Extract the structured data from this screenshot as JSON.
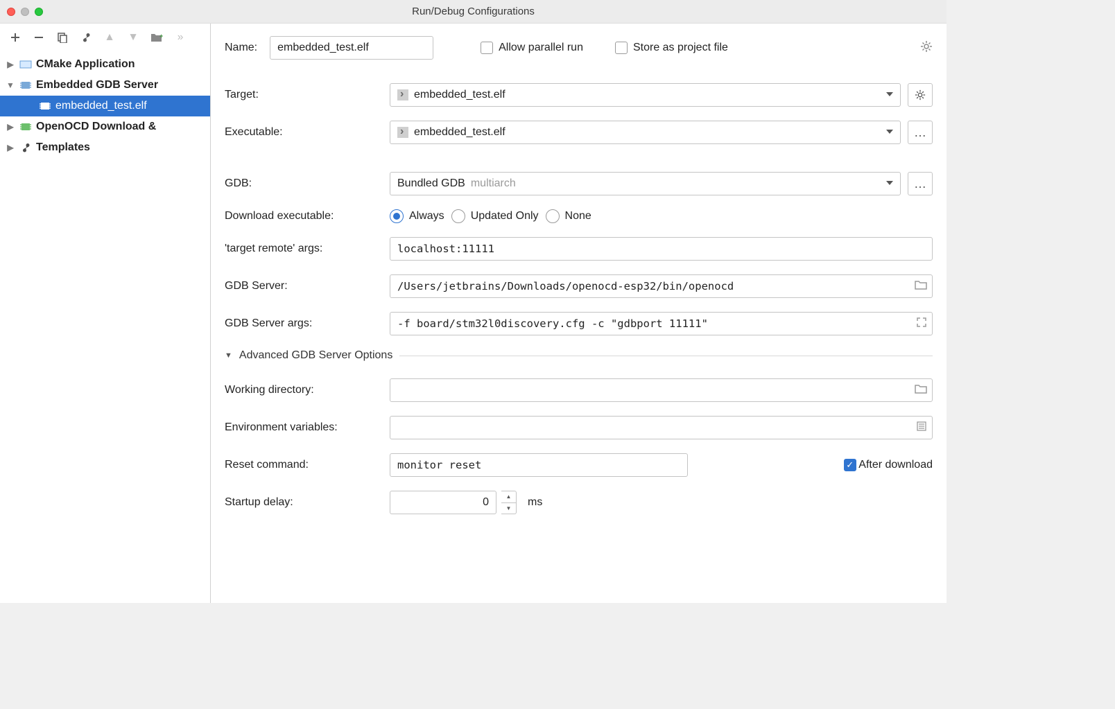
{
  "window": {
    "title": "Run/Debug Configurations"
  },
  "tree": {
    "items": [
      {
        "label": "CMake Application",
        "kind": "cmake"
      },
      {
        "label": "Embedded GDB Server",
        "kind": "chip-blue"
      },
      {
        "label": "embedded_test.elf",
        "kind": "chip-blue"
      },
      {
        "label": "OpenOCD Download & ",
        "kind": "chip-green"
      },
      {
        "label": "Templates",
        "kind": "wrench"
      }
    ]
  },
  "form": {
    "name_label": "Name:",
    "name_value": "embedded_test.elf",
    "allow_parallel": "Allow parallel run",
    "store_as_file": "Store as project file",
    "target_label": "Target:",
    "target_value": "embedded_test.elf",
    "executable_label": "Executable:",
    "executable_value": "embedded_test.elf",
    "gdb_label": "GDB:",
    "gdb_value": "Bundled GDB",
    "gdb_suffix": "multiarch",
    "download_label": "Download executable:",
    "download_options": {
      "always": "Always",
      "updated": "Updated Only",
      "none": "None"
    },
    "remote_args_label": "'target remote' args:",
    "remote_args_value": "localhost:11111",
    "server_label": "GDB Server:",
    "server_value": "/Users/jetbrains/Downloads/openocd-esp32/bin/openocd",
    "server_args_label": "GDB Server args:",
    "server_args_value": "-f board/stm32l0discovery.cfg -c \"gdbport 11111\"",
    "advanced_header": "Advanced GDB Server Options",
    "workdir_label": "Working directory:",
    "workdir_value": "",
    "env_label": "Environment variables:",
    "env_value": "",
    "reset_label": "Reset command:",
    "reset_value": "monitor reset",
    "after_download": "After download",
    "delay_label": "Startup delay:",
    "delay_value": "0",
    "delay_unit": "ms"
  }
}
